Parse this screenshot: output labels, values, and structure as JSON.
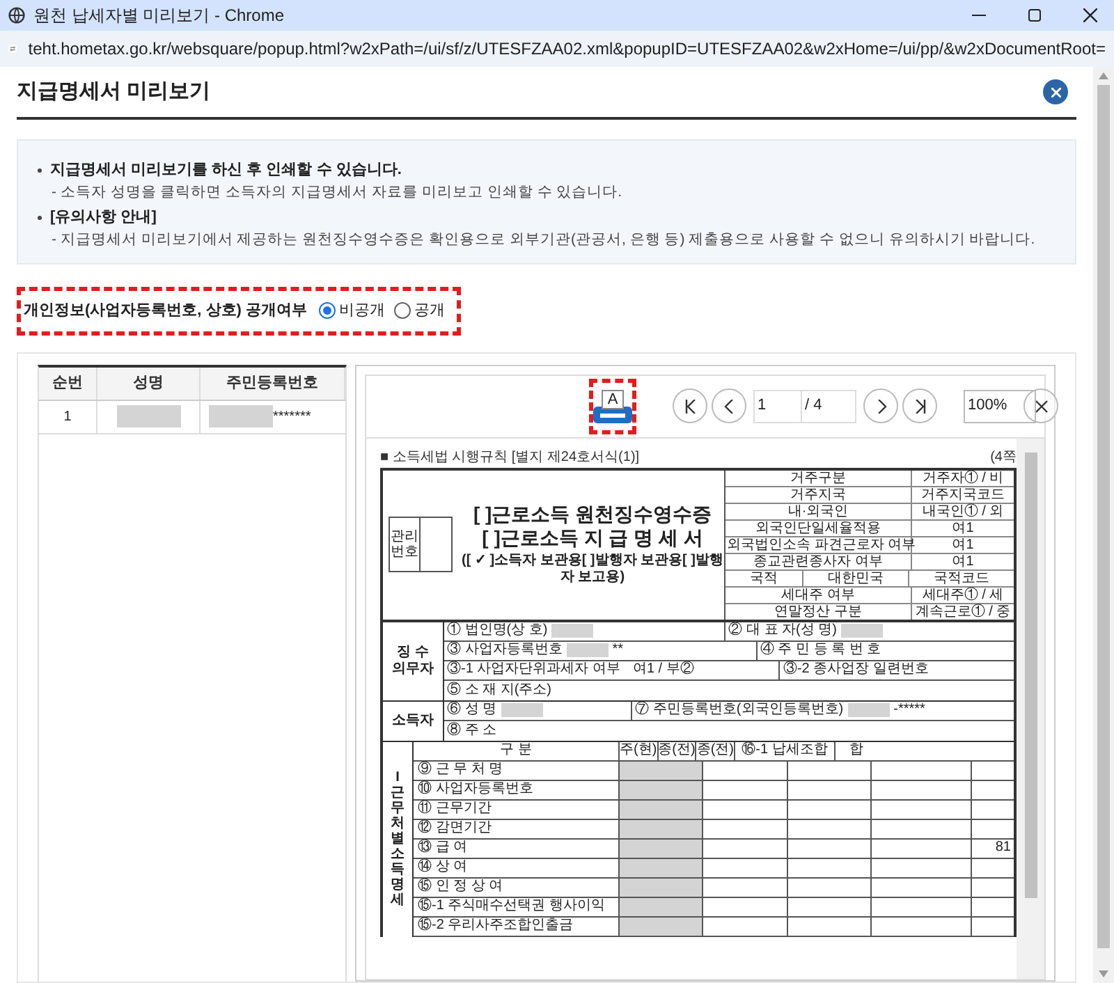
{
  "window": {
    "title": "원천 납세자별 미리보기 - Chrome"
  },
  "address_bar": {
    "url": "teht.hometax.go.kr/websquare/popup.html?w2xPath=/ui/sf/z/UTESFZAA02.xml&popupID=UTESFZAA02&w2xHome=/ui/pp/&w2xDocumentRoot="
  },
  "dialog": {
    "title": "지급명세서 미리보기"
  },
  "notices": [
    {
      "heading": "지급명세서 미리보기를 하신 후 인쇄할 수 있습니다.",
      "detail": "- 소득자 성명을 클릭하면 소득자의 지급명세서 자료를 미리보고 인쇄할 수 있습니다."
    },
    {
      "heading": "[유의사항 안내]",
      "detail": "- 지급명세서 미리보기에서 제공하는 원천징수영수증은 확인용으로 외부기관(관공서, 은행 등) 제출용으로 사용할 수 없으니 유의하시기 바랍니다."
    }
  ],
  "privacy": {
    "label": "개인정보(사업자등록번호, 상호) 공개여부",
    "options": [
      {
        "label": "비공개",
        "selected": true
      },
      {
        "label": "공개",
        "selected": false
      }
    ]
  },
  "taxpayers": {
    "columns": [
      "순번",
      "성명",
      "주민등록번호"
    ],
    "rows": [
      {
        "no": "1",
        "id_suffix": "*******"
      }
    ]
  },
  "viewer": {
    "print_glyph": "A",
    "page": "1",
    "total": "/ 4",
    "zoom": "100%"
  },
  "document": {
    "regulation": "■ 소득세법 시행규칙 [별지 제24호서식(1)]",
    "page_mark": "(4쪽",
    "mgmt_label": "관리 번호",
    "titles": [
      "[ ]근로소득 원천징수영수증",
      "[ ]근로소득 지 급 명 세 서"
    ],
    "copy_line": "([ ✓ ]소득자 보관용[    ]발행자 보관용[    ]발행자 보고용)",
    "residency": [
      [
        "거주구분",
        "거주자① / 비"
      ],
      [
        "거주지국",
        "거주지국코드"
      ],
      [
        "내·외국인",
        "내국인① / 외"
      ],
      [
        "외국인단일세율적용",
        "여1"
      ],
      [
        "외국법인소속 파견근로자 여부",
        "여1"
      ],
      [
        "종교관련종사자 여부",
        "여1"
      ],
      [
        "국적",
        "대한민국",
        "국적코드"
      ],
      [
        "세대주 여부",
        "세대주① / 세"
      ],
      [
        "연말정산 구분",
        "계속근로① / 중"
      ]
    ],
    "withholder": {
      "label": "징 수 의무자",
      "rows": [
        [
          {
            "label": "① 법인명(상 호)",
            "value": {
              "kind": "masked"
            }
          },
          {
            "label": "② 대 표 자(성 명)",
            "value": {
              "kind": "masked"
            }
          }
        ],
        [
          {
            "label": "③ 사업자등록번호",
            "value": {
              "kind": "masked",
              "suffix": "**"
            }
          },
          {
            "label": "④ 주 민 등 록 번 호"
          }
        ],
        [
          {
            "label": "③-1 사업자단위과세자 여부",
            "value": {
              "kind": "text",
              "text": "여1 / 부②"
            }
          },
          {
            "label": "③-2 종사업장 일련번호"
          }
        ],
        [
          {
            "label": "⑤ 소 재 지(주소)"
          }
        ]
      ]
    },
    "earner": {
      "label": "소득자",
      "rows": [
        [
          {
            "label": "⑥ 성 명",
            "value": {
              "kind": "masked"
            }
          },
          {
            "label": "⑦ 주민등록번호(외국인등록번호)",
            "value": {
              "kind": "masked",
              "suffix": "-*****"
            }
          }
        ],
        [
          {
            "label": "⑧ 주 소"
          }
        ]
      ]
    },
    "income": {
      "side_label": "I근무처별소득명세",
      "columns": [
        "구 분",
        "주(현)",
        "종(전)",
        "종(전)",
        "⑯-1 납세조합",
        "합"
      ],
      "rows": [
        {
          "label": "⑨ 근 무 처 명"
        },
        {
          "label": "⑩ 사업자등록번호"
        },
        {
          "label": "⑪ 근무기간"
        },
        {
          "label": "⑫ 감면기간"
        },
        {
          "label": "⑬ 급 여",
          "total": "81"
        },
        {
          "label": "⑭ 상 여"
        },
        {
          "label": "⑮ 인 정 상 여"
        },
        {
          "label": "⑮-1 주식매수선택권 행사이익"
        },
        {
          "label": "⑮-2 우리사주조합인출금"
        }
      ]
    }
  }
}
